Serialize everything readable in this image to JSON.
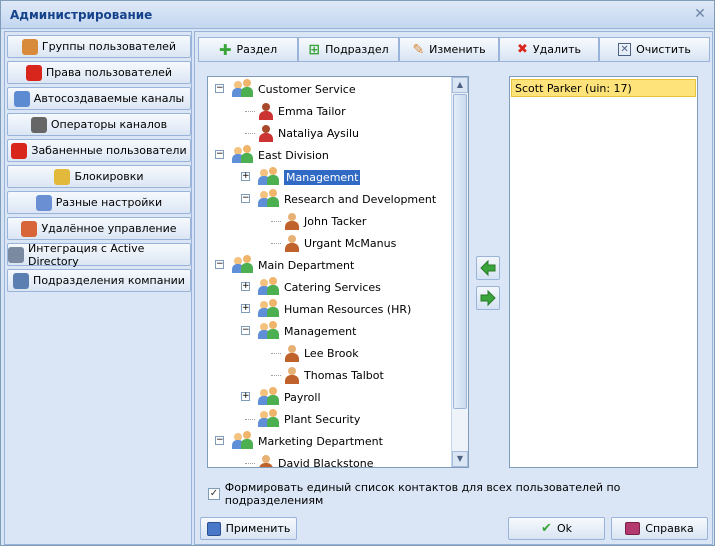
{
  "window": {
    "title": "Администрирование"
  },
  "sidebar": {
    "items": [
      {
        "label": "Группы пользователей",
        "icon": "users-group-icon",
        "color": "#d88b3b"
      },
      {
        "label": "Права пользователей",
        "icon": "forbidden-icon",
        "color": "#d9261c"
      },
      {
        "label": "Автосоздаваемые каналы",
        "icon": "auto-channels-icon",
        "color": "#5d8bd1"
      },
      {
        "label": "Операторы каналов",
        "icon": "operator-icon",
        "color": "#666666"
      },
      {
        "label": "Забаненные пользователи",
        "icon": "banned-icon",
        "color": "#d9261c"
      },
      {
        "label": "Блокировки",
        "icon": "lock-icon",
        "color": "#e2b93b"
      },
      {
        "label": "Разные настройки",
        "icon": "settings-icon",
        "color": "#6b8fd3"
      },
      {
        "label": "Удалённое управление",
        "icon": "remote-control-icon",
        "color": "#d8643a"
      },
      {
        "label": "Интеграция с Active Directory",
        "icon": "active-directory-icon",
        "color": "#7a8aa0"
      },
      {
        "label": "Подразделения компании",
        "icon": "company-divisions-icon",
        "color": "#5b7fb0"
      }
    ]
  },
  "toolbar": {
    "add_section": "Раздел",
    "add_subsection": "Подраздел",
    "edit": "Изменить",
    "delete": "Удалить",
    "clear": "Очистить"
  },
  "tree": {
    "nodes": [
      {
        "label": "Customer Service",
        "type": "group",
        "level": 0,
        "expander": "minus"
      },
      {
        "label": "Emma Tailor",
        "type": "user-f",
        "level": 1,
        "expander": ""
      },
      {
        "label": "Nataliya Aysilu",
        "type": "user-f",
        "level": 1,
        "expander": ""
      },
      {
        "label": "East Division",
        "type": "group",
        "level": 0,
        "expander": "minus"
      },
      {
        "label": "Management",
        "type": "group",
        "level": 1,
        "expander": "plus",
        "selected": true
      },
      {
        "label": "Research and Development",
        "type": "group",
        "level": 1,
        "expander": "minus"
      },
      {
        "label": "John Tacker",
        "type": "user",
        "level": 2,
        "expander": ""
      },
      {
        "label": "Urgant McManus",
        "type": "user",
        "level": 2,
        "expander": ""
      },
      {
        "label": "Main Department",
        "type": "group",
        "level": 0,
        "expander": "minus"
      },
      {
        "label": "Catering Services",
        "type": "group",
        "level": 1,
        "expander": "plus"
      },
      {
        "label": "Human Resources (HR)",
        "type": "group",
        "level": 1,
        "expander": "plus"
      },
      {
        "label": "Management",
        "type": "group",
        "level": 1,
        "expander": "minus"
      },
      {
        "label": "Lee Brook",
        "type": "user",
        "level": 2,
        "expander": ""
      },
      {
        "label": "Thomas Talbot",
        "type": "user",
        "level": 2,
        "expander": ""
      },
      {
        "label": "Payroll",
        "type": "group",
        "level": 1,
        "expander": "plus"
      },
      {
        "label": "Plant Security",
        "type": "group",
        "level": 1,
        "expander": ""
      },
      {
        "label": "Marketing Department",
        "type": "group",
        "level": 0,
        "expander": "minus"
      },
      {
        "label": "David Blackstone",
        "type": "user",
        "level": 1,
        "expander": ""
      }
    ]
  },
  "list": {
    "items": [
      "Scott Parker (uin: 17)"
    ]
  },
  "checkbox": {
    "label": "Формировать единый список контактов для всех пользователей по подразделениям",
    "checked": true
  },
  "buttons": {
    "apply": "Применить",
    "ok": "Ok",
    "help": "Справка"
  },
  "colors": {
    "accent": "#316ac5",
    "list_highlight": "#fde37a",
    "arrow_green": "#3aa53a"
  }
}
